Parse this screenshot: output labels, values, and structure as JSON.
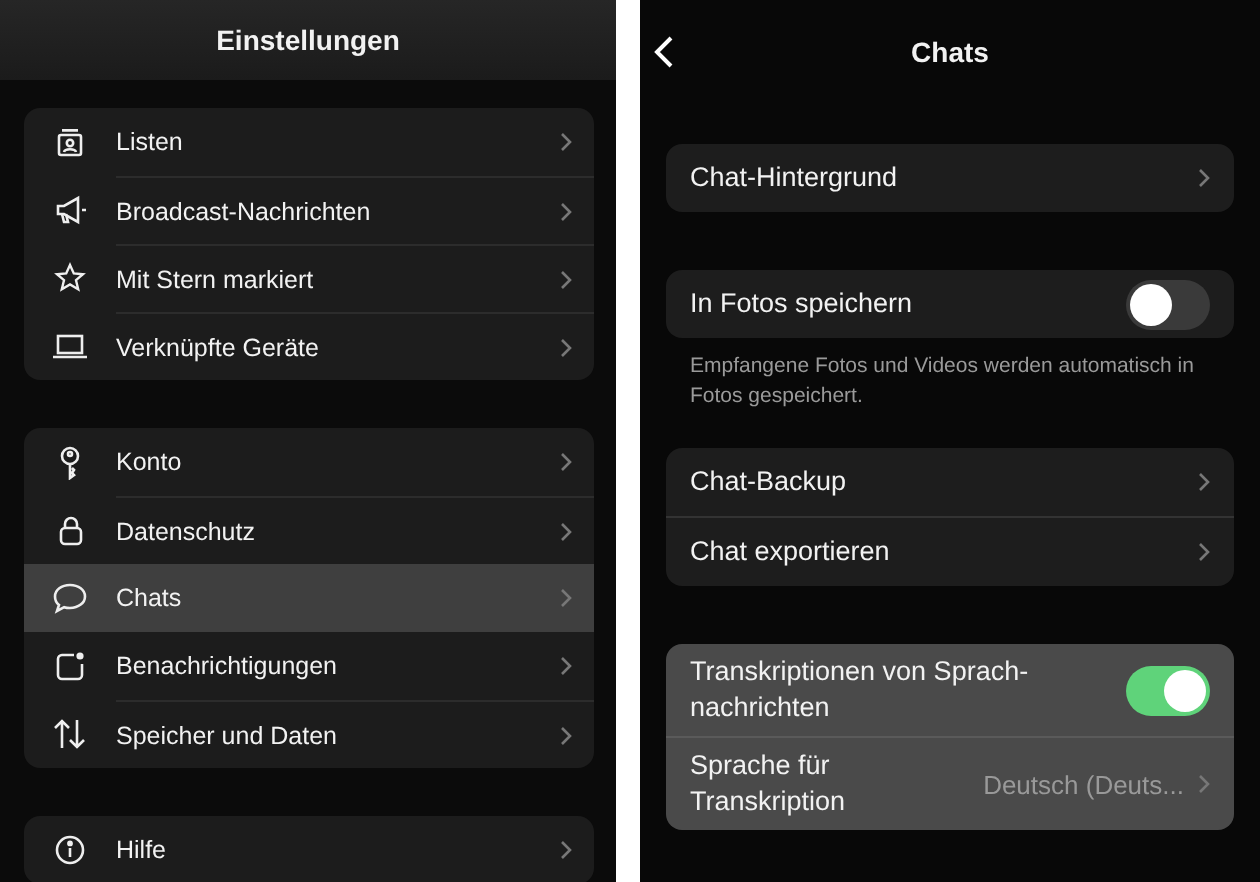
{
  "left_screen": {
    "title": "Einstellungen",
    "groups": [
      {
        "items": [
          {
            "label": "Listen",
            "selected": false
          },
          {
            "label": "Broadcast-Nachrichten",
            "selected": false
          },
          {
            "label": "Mit Stern markiert",
            "selected": false
          },
          {
            "label": "Verknüpfte Geräte",
            "selected": false
          }
        ]
      },
      {
        "items": [
          {
            "label": "Konto",
            "selected": false
          },
          {
            "label": "Datenschutz",
            "selected": false
          },
          {
            "label": "Chats",
            "selected": true
          },
          {
            "label": "Benachrichtigungen",
            "selected": false
          },
          {
            "label": "Speicher und Daten",
            "selected": false
          }
        ]
      },
      {
        "items": [
          {
            "label": "Hilfe",
            "selected": false
          }
        ]
      }
    ]
  },
  "right_screen": {
    "title": "Chats",
    "groups": [
      {
        "highlighted": false,
        "items": [
          {
            "kind": "link",
            "label": "Chat-Hintergrund"
          }
        ]
      },
      {
        "highlighted": false,
        "items": [
          {
            "kind": "toggle",
            "label": "In Fotos speichern",
            "on": false
          }
        ],
        "footnote": "Empfangene Fotos und Videos werden automatisch in Fotos gespeichert."
      },
      {
        "highlighted": false,
        "items": [
          {
            "kind": "link",
            "label": "Chat-Backup"
          },
          {
            "kind": "link",
            "label": "Chat exportieren"
          }
        ]
      },
      {
        "highlighted": true,
        "items": [
          {
            "kind": "toggle",
            "label": "Transkriptionen von Sprach-nachrichten",
            "on": true
          },
          {
            "kind": "link",
            "label": "Sprache für Transkription",
            "value": "Deutsch (Deuts..."
          }
        ]
      }
    ]
  }
}
